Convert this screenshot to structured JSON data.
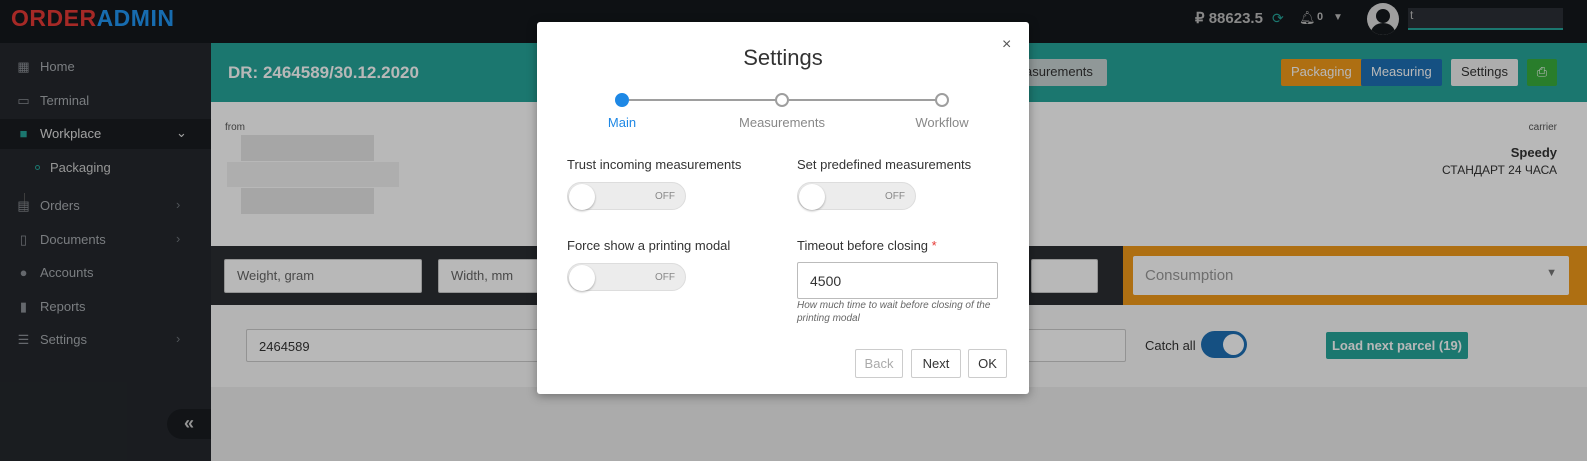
{
  "topbar": {
    "logo_part1": "ORDER",
    "logo_part2": "ADMIN",
    "balance": "₽ 88623.5",
    "notifications_count": "0",
    "username": "t"
  },
  "sidebar": {
    "items": [
      {
        "label": "Home",
        "icon": "grid-icon"
      },
      {
        "label": "Terminal",
        "icon": "monitor-icon"
      },
      {
        "label": "Workplace",
        "icon": "truck-icon"
      },
      {
        "label": "Orders",
        "icon": "box-icon"
      },
      {
        "label": "Documents",
        "icon": "document-icon"
      },
      {
        "label": "Accounts",
        "icon": "user-icon"
      },
      {
        "label": "Reports",
        "icon": "report-icon"
      },
      {
        "label": "Settings",
        "icon": "sliders-icon"
      }
    ],
    "sub_item": "Packaging",
    "collapse": "«"
  },
  "main": {
    "title": "DR: 2464589/30.12.2020",
    "measurements_btn": "asurements",
    "packaging_btn": "Packaging",
    "measuring_btn": "Measuring",
    "settings_btn": "Settings",
    "print_icon": "print-icon",
    "from_label": "from",
    "carrier_label": "carrier",
    "carrier_name": "Speedy",
    "carrier_service": "СТАНДАРТ 24 ЧАСА",
    "weight_placeholder": "Weight, gram",
    "width_placeholder": "Width, mm",
    "consumption_placeholder": "Consumption",
    "barcode_value": "2464589",
    "catch_all_label": "Catch all",
    "load_next_label": "Load next parcel (19)"
  },
  "modal": {
    "title": "Settings",
    "close": "×",
    "steps": [
      {
        "label": "Main",
        "active": true
      },
      {
        "label": "Measurements",
        "active": false
      },
      {
        "label": "Workflow",
        "active": false
      }
    ],
    "options": {
      "trust_incoming": {
        "label": "Trust incoming measurements",
        "state": "OFF"
      },
      "set_predefined": {
        "label": "Set predefined measurements",
        "state": "OFF"
      },
      "force_print": {
        "label": "Force show a printing modal",
        "state": "OFF"
      }
    },
    "timeout": {
      "label": "Timeout before closing",
      "required_mark": "*",
      "value": "4500",
      "hint": "How much time to wait before closing of the printing modal"
    },
    "buttons": {
      "back": "Back",
      "next": "Next",
      "ok": "OK"
    }
  },
  "colors": {
    "accent_teal": "#26a69a",
    "accent_blue": "#1e6fb5",
    "accent_orange": "#f29a19",
    "step_active": "#1e88e5"
  }
}
